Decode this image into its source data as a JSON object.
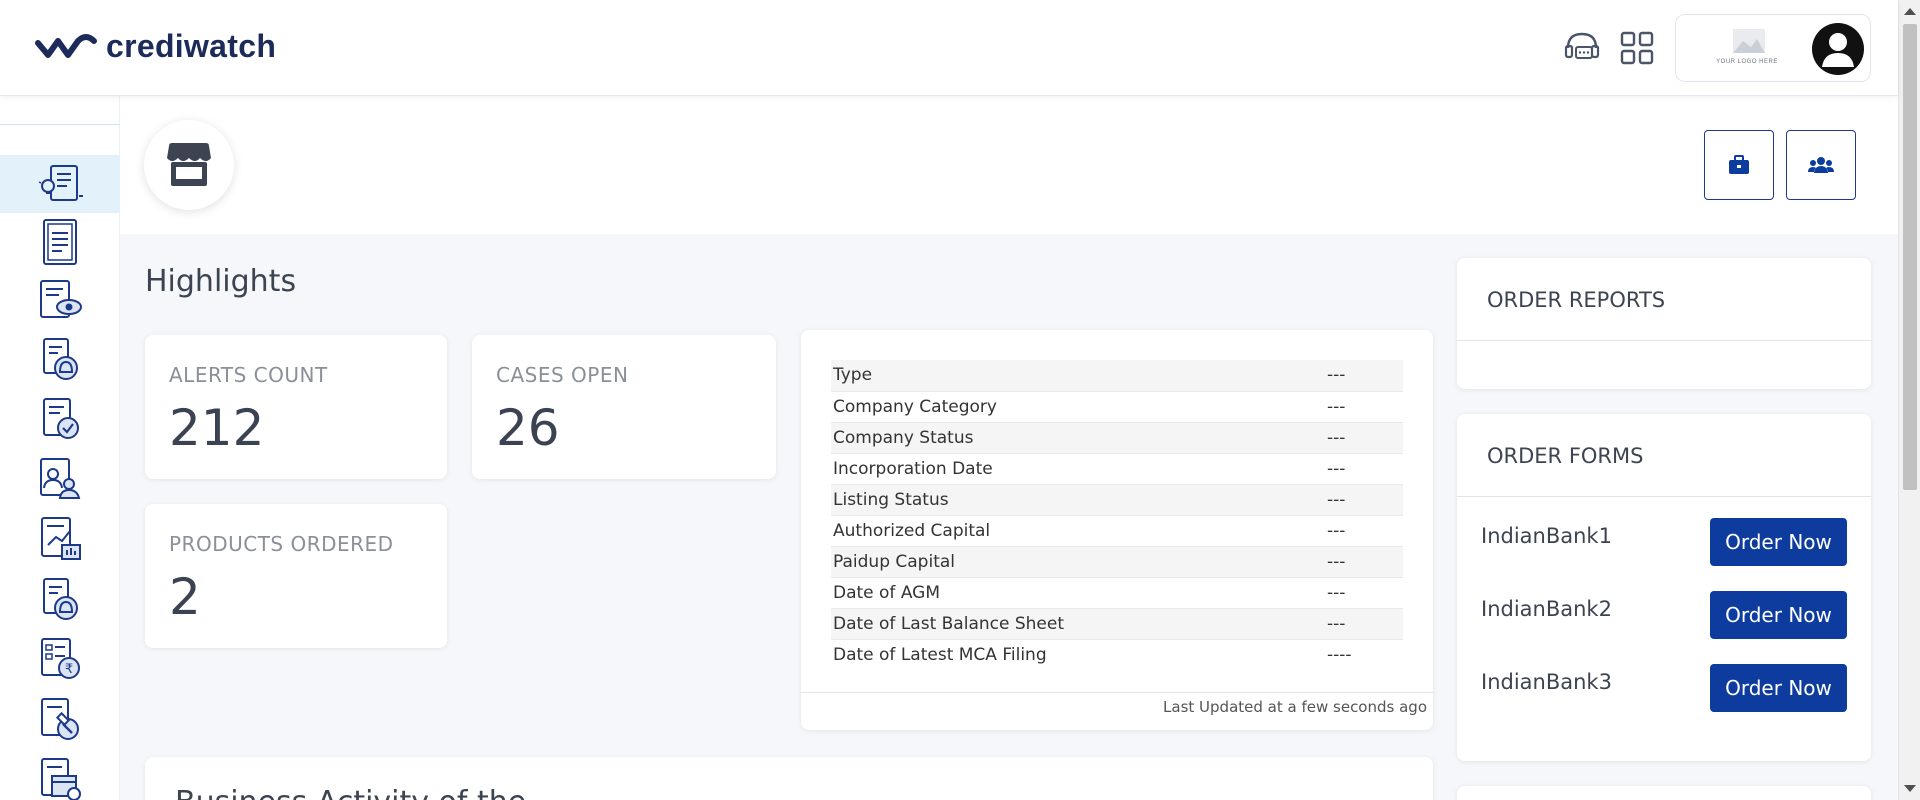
{
  "header": {
    "logo_text": "crediwatch",
    "support_icon": "headset-icon",
    "apps_icon": "grid-icon",
    "brand_logo_text": "YOUR LOGO HERE",
    "avatar_icon": "user-avatar-icon"
  },
  "sidebar": {
    "items": [
      {
        "icon": "insights-report-icon",
        "active": true
      },
      {
        "icon": "document-icon"
      },
      {
        "icon": "document-view-icon"
      },
      {
        "icon": "document-alert-icon"
      },
      {
        "icon": "document-check-icon"
      },
      {
        "icon": "document-people-icon"
      },
      {
        "icon": "document-chart-icon"
      },
      {
        "icon": "document-alert-icon"
      },
      {
        "icon": "document-rupee-icon"
      },
      {
        "icon": "document-legal-icon"
      },
      {
        "icon": "document-calendar-icon"
      }
    ]
  },
  "subheader": {
    "store_icon": "store-icon",
    "portfolio_icon": "briefcase-icon",
    "users_icon": "users-icon"
  },
  "highlights": {
    "title": "Highlights",
    "stats": [
      {
        "label": "ALERTS COUNT",
        "value": "212"
      },
      {
        "label": "CASES OPEN",
        "value": "26"
      },
      {
        "label": "PRODUCTS ORDERED",
        "value": "2"
      }
    ]
  },
  "company_info": {
    "rows": [
      {
        "label": "Type",
        "value": "---"
      },
      {
        "label": "Company Category",
        "value": "---"
      },
      {
        "label": "Company Status",
        "value": "---"
      },
      {
        "label": "Incorporation Date",
        "value": "---"
      },
      {
        "label": "Listing Status",
        "value": "---"
      },
      {
        "label": "Authorized Capital",
        "value": "---"
      },
      {
        "label": "Paidup Capital",
        "value": "---"
      },
      {
        "label": "Date of AGM",
        "value": "---"
      },
      {
        "label": "Date of Last Balance Sheet",
        "value": "---"
      },
      {
        "label": "Date of Latest MCA Filing",
        "value": "----"
      }
    ],
    "footer": "Last Updated at a few seconds ago"
  },
  "business_activity": {
    "title": "Business Activity of the"
  },
  "order_reports": {
    "title": "ORDER REPORTS"
  },
  "order_forms": {
    "title": "ORDER FORMS",
    "items": [
      {
        "name": "IndianBank1",
        "button": "Order Now"
      },
      {
        "name": "IndianBank2",
        "button": "Order Now"
      },
      {
        "name": "IndianBank3",
        "button": "Order Now"
      }
    ]
  },
  "colors": {
    "brand_navy": "#1c2b5a",
    "primary_button": "#0d3c9e",
    "sidebar_active": "#e3f1fb",
    "page_bg": "#f5f7fb"
  }
}
